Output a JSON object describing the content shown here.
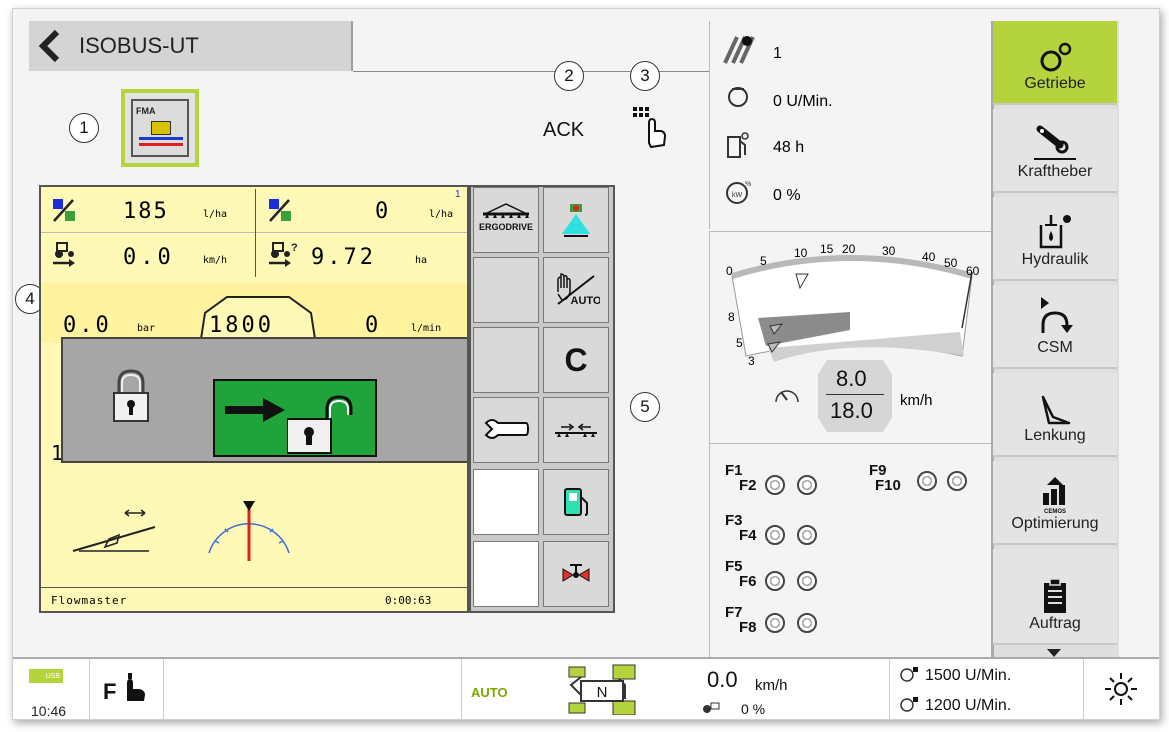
{
  "header": {
    "title": "ISOBUS-UT"
  },
  "callouts": [
    "1",
    "2",
    "3",
    "4",
    "5"
  ],
  "ack_label": "ACK",
  "implement": {
    "row1": {
      "rate": "185",
      "rate_unit": "l/ha",
      "rate2": "0",
      "rate2_unit": "l/ha",
      "superscript": "1"
    },
    "row2": {
      "speed": "0.0",
      "speed_unit": "km/h",
      "area": "9.72",
      "area_unit": "ha"
    },
    "row3": {
      "pressure": "0.0",
      "pressure_unit": "bar",
      "center_value": "1800",
      "flow": "0",
      "flow_unit": "l/min"
    },
    "partial_digit": "1",
    "footer_name": "Flowmaster",
    "footer_time": "0:00:63"
  },
  "softkeys": [
    {
      "icon": "ergodrive-icon",
      "label": "ERGODRIVE"
    },
    {
      "icon": "nozzle-icon"
    },
    {
      "icon": "blank"
    },
    {
      "icon": "manual-auto-icon",
      "label": "AUTO"
    },
    {
      "icon": "blank"
    },
    {
      "icon": "c-icon",
      "label": "C"
    },
    {
      "icon": "wrench-icon"
    },
    {
      "icon": "boom-fold-icon"
    },
    {
      "icon": "blank-white"
    },
    {
      "icon": "fuel-icon"
    },
    {
      "icon": "blank-white"
    },
    {
      "icon": "valve-icon"
    }
  ],
  "status_panel": {
    "tramline": "1",
    "rpm": "0 U/Min.",
    "hours": "48 h",
    "percent": "0 %"
  },
  "gauge": {
    "ticks": [
      "0",
      "5",
      "10",
      "15",
      "20",
      "30",
      "40",
      "50",
      "60"
    ],
    "left_ticks": [
      "8",
      "5",
      "3"
    ],
    "speed_top": "8.0",
    "speed_bottom": "18.0",
    "unit": "km/h"
  },
  "function_keys": {
    "left": [
      [
        "F1",
        "F2"
      ],
      [
        "F3",
        "F4"
      ],
      [
        "F5",
        "F6"
      ],
      [
        "F7",
        "F8"
      ]
    ],
    "right": [
      [
        "F9",
        "F10"
      ]
    ]
  },
  "sidebar": [
    {
      "label": "Getriebe",
      "icon": "gears-icon",
      "active": true
    },
    {
      "label": "Kraftheber",
      "icon": "hitch-icon"
    },
    {
      "label": "Hydraulik",
      "icon": "hydraulic-icon"
    },
    {
      "label": "CSM",
      "icon": "csm-icon"
    },
    {
      "label": "Lenkung",
      "icon": "steering-icon"
    },
    {
      "label": "Optimierung",
      "icon": "cemos-icon",
      "sublabel": "CEMOS"
    },
    {
      "label": "Auftrag",
      "icon": "clipboard-icon"
    }
  ],
  "bottom_bar": {
    "usb": "USB",
    "time": "10:46",
    "f_label": "F",
    "auto": "AUTO",
    "gear": "N",
    "speed": "0.0",
    "speed_unit": "km/h",
    "slip": "0 %",
    "rpm1": "1500 U/Min.",
    "rpm2": "1200 U/Min."
  },
  "colors": {
    "accent": "#b5d33d",
    "implement_bg": "#fff9b8",
    "unlock_green": "#1fa33a"
  }
}
